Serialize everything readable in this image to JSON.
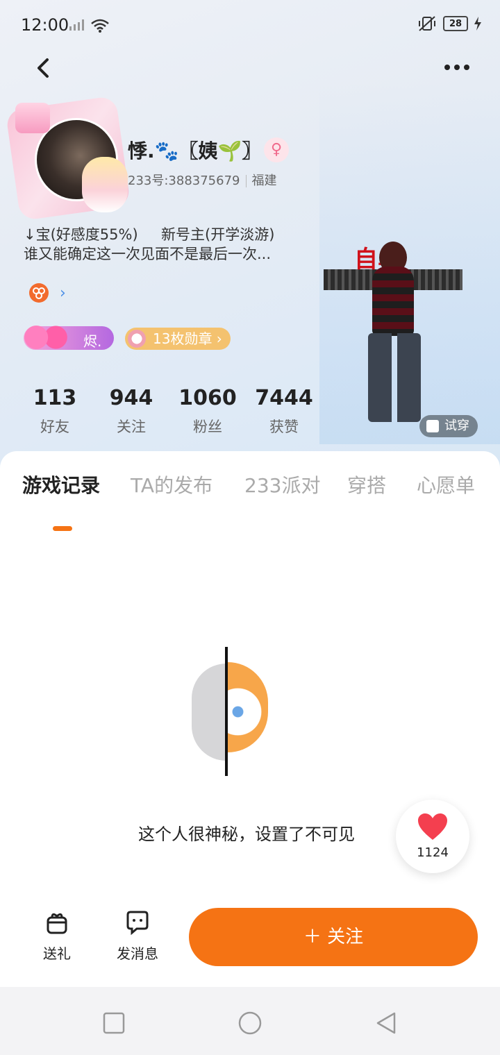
{
  "status_bar": {
    "time": "12:00",
    "battery": "28"
  },
  "profile": {
    "name": "悸.🐾〖姨🌱〗",
    "gender_symbol": "♀",
    "id_text": "233号:388375679",
    "region": "福建",
    "bio_line1": "↓宝(好感度55%)     新号主(开学淡游)",
    "bio_line2": "谁又能确定这一次见面不是最后一次...",
    "badge_label": "烬.",
    "medal_text": "13枚勋章 ›",
    "character_title": "自卑",
    "try_on_label": "试穿"
  },
  "stats": [
    {
      "value": "113",
      "label": "好友"
    },
    {
      "value": "944",
      "label": "关注"
    },
    {
      "value": "1060",
      "label": "粉丝"
    },
    {
      "value": "7444",
      "label": "获赞"
    }
  ],
  "tabs": [
    {
      "label": "游戏记录",
      "active": true
    },
    {
      "label": "TA的发布",
      "active": false
    },
    {
      "label": "233派对",
      "active": false
    },
    {
      "label": "穿搭",
      "active": false
    },
    {
      "label": "心愿单",
      "active": false
    }
  ],
  "empty_state": {
    "message": "这个人很神秘，设置了不可见"
  },
  "like": {
    "count": "1124"
  },
  "actions": {
    "gift_label": "送礼",
    "message_label": "发消息",
    "follow_label": "＋ 关注"
  },
  "colors": {
    "accent": "#f57314",
    "gender": "#f06a8c",
    "link": "#4a8fe6"
  },
  "icons": [
    "back-arrow-icon",
    "more-icon",
    "gift-icon",
    "chat-icon",
    "heart-icon",
    "square-icon",
    "circle-icon",
    "triangle-back-icon"
  ]
}
